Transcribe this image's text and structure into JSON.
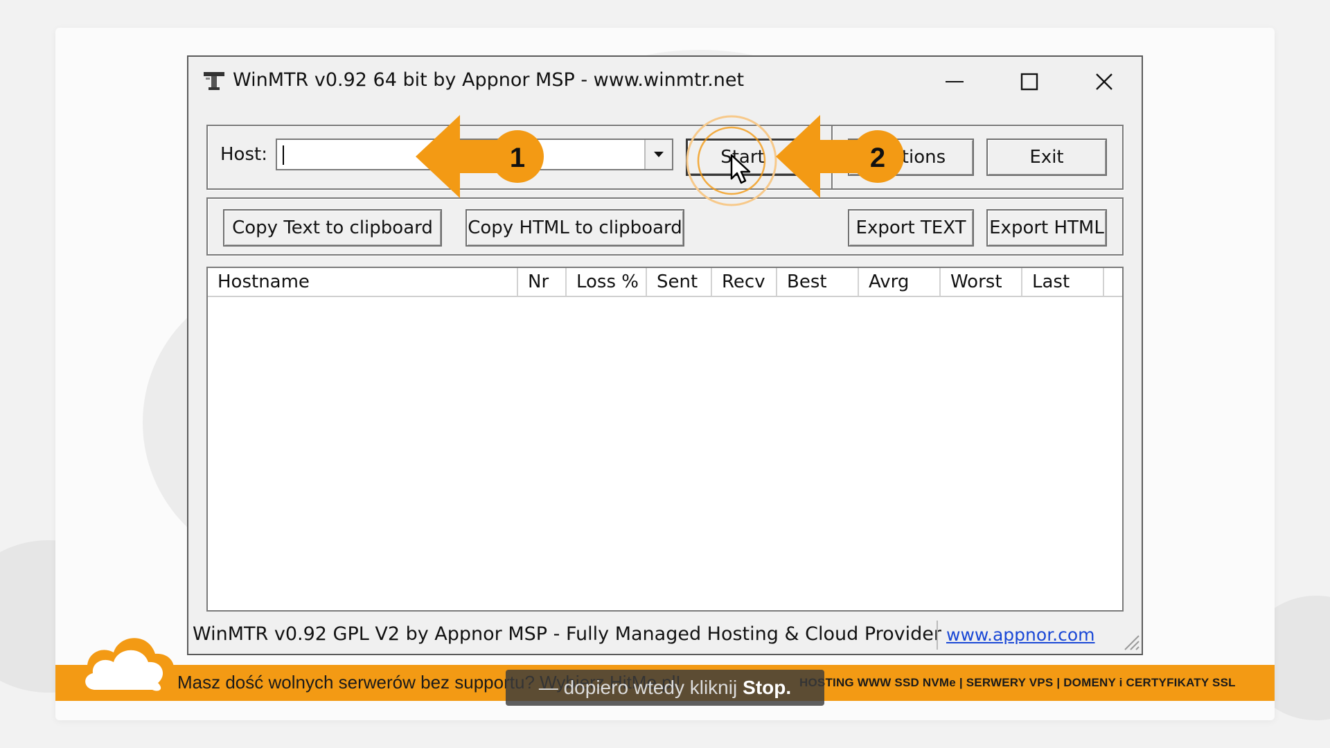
{
  "window": {
    "title": "WinMTR v0.92 64 bit by Appnor MSP - www.winmtr.net",
    "controls": {
      "minimize": "minimize-icon",
      "maximize": "maximize-icon",
      "close": "close-icon"
    }
  },
  "host": {
    "label": "Host:",
    "value": ""
  },
  "buttons": {
    "start": "Start",
    "options": "Options",
    "exit": "Exit",
    "copy_text": "Copy Text to clipboard",
    "copy_html": "Copy HTML to clipboard",
    "export_text": "Export TEXT",
    "export_html": "Export HTML"
  },
  "table": {
    "columns": [
      "Hostname",
      "Nr",
      "Loss %",
      "Sent",
      "Recv",
      "Best",
      "Avrg",
      "Worst",
      "Last"
    ],
    "rows": []
  },
  "status": {
    "text": "WinMTR v0.92 GPL V2 by Appnor MSP - Fully Managed Hosting & Cloud Provider",
    "link": "www.appnor.com"
  },
  "annotations": {
    "step1": "1",
    "step2": "2",
    "accent": "#f39a14"
  },
  "banner": {
    "main": "Masz dość wolnych serwerów bez supportu? Wybierz HitMe.pl!",
    "right": "HOSTING WWW SSD NVMe | SERWERY VPS | DOMENY i CERTYFIKATY SSL"
  },
  "subtitle": {
    "text": "— dopiero wtedy kliknij",
    "emphasis": "Stop."
  }
}
